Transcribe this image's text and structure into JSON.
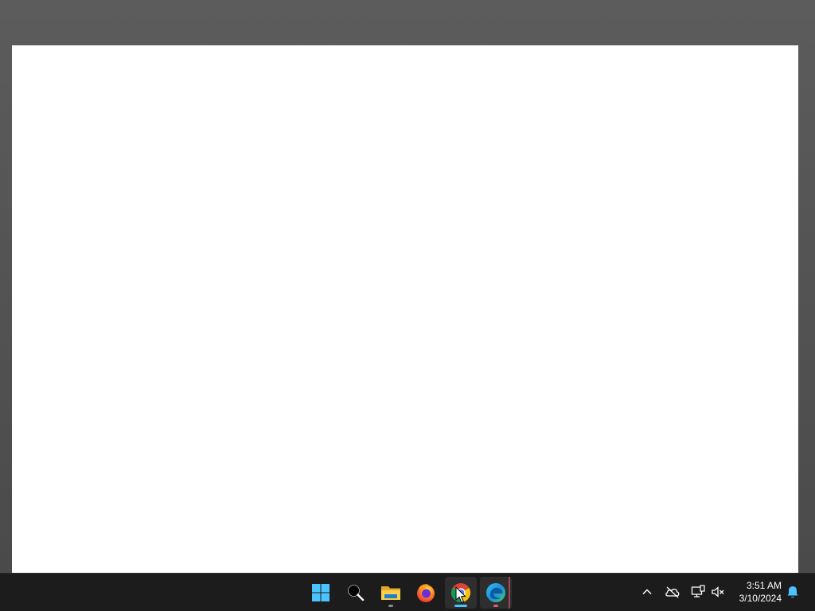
{
  "window": {
    "title": "",
    "content_background": "#ffffff"
  },
  "taskbar": {
    "background": "#1c1c1c",
    "apps": [
      {
        "name": "Start",
        "icon": "windows-logo-icon"
      },
      {
        "name": "Search",
        "icon": "search-icon"
      },
      {
        "name": "File Explorer",
        "icon": "folder-icon",
        "running": true
      },
      {
        "name": "Firefox",
        "icon": "firefox-icon"
      },
      {
        "name": "Google Chrome",
        "icon": "chrome-icon",
        "running": true,
        "active": true
      },
      {
        "name": "Microsoft Edge",
        "icon": "edge-icon",
        "running": true
      }
    ],
    "accent_active": "#4cc2ff",
    "accent_running": "#8a8a8a",
    "accent_edge": "#e45a75"
  },
  "tray": {
    "icons": [
      "chevron-up-icon",
      "onedrive-offline-icon",
      "network-icon",
      "volume-muted-icon"
    ],
    "time": "3:51 AM",
    "date": "3/10/2024",
    "notification_icon": "bell-icon"
  }
}
